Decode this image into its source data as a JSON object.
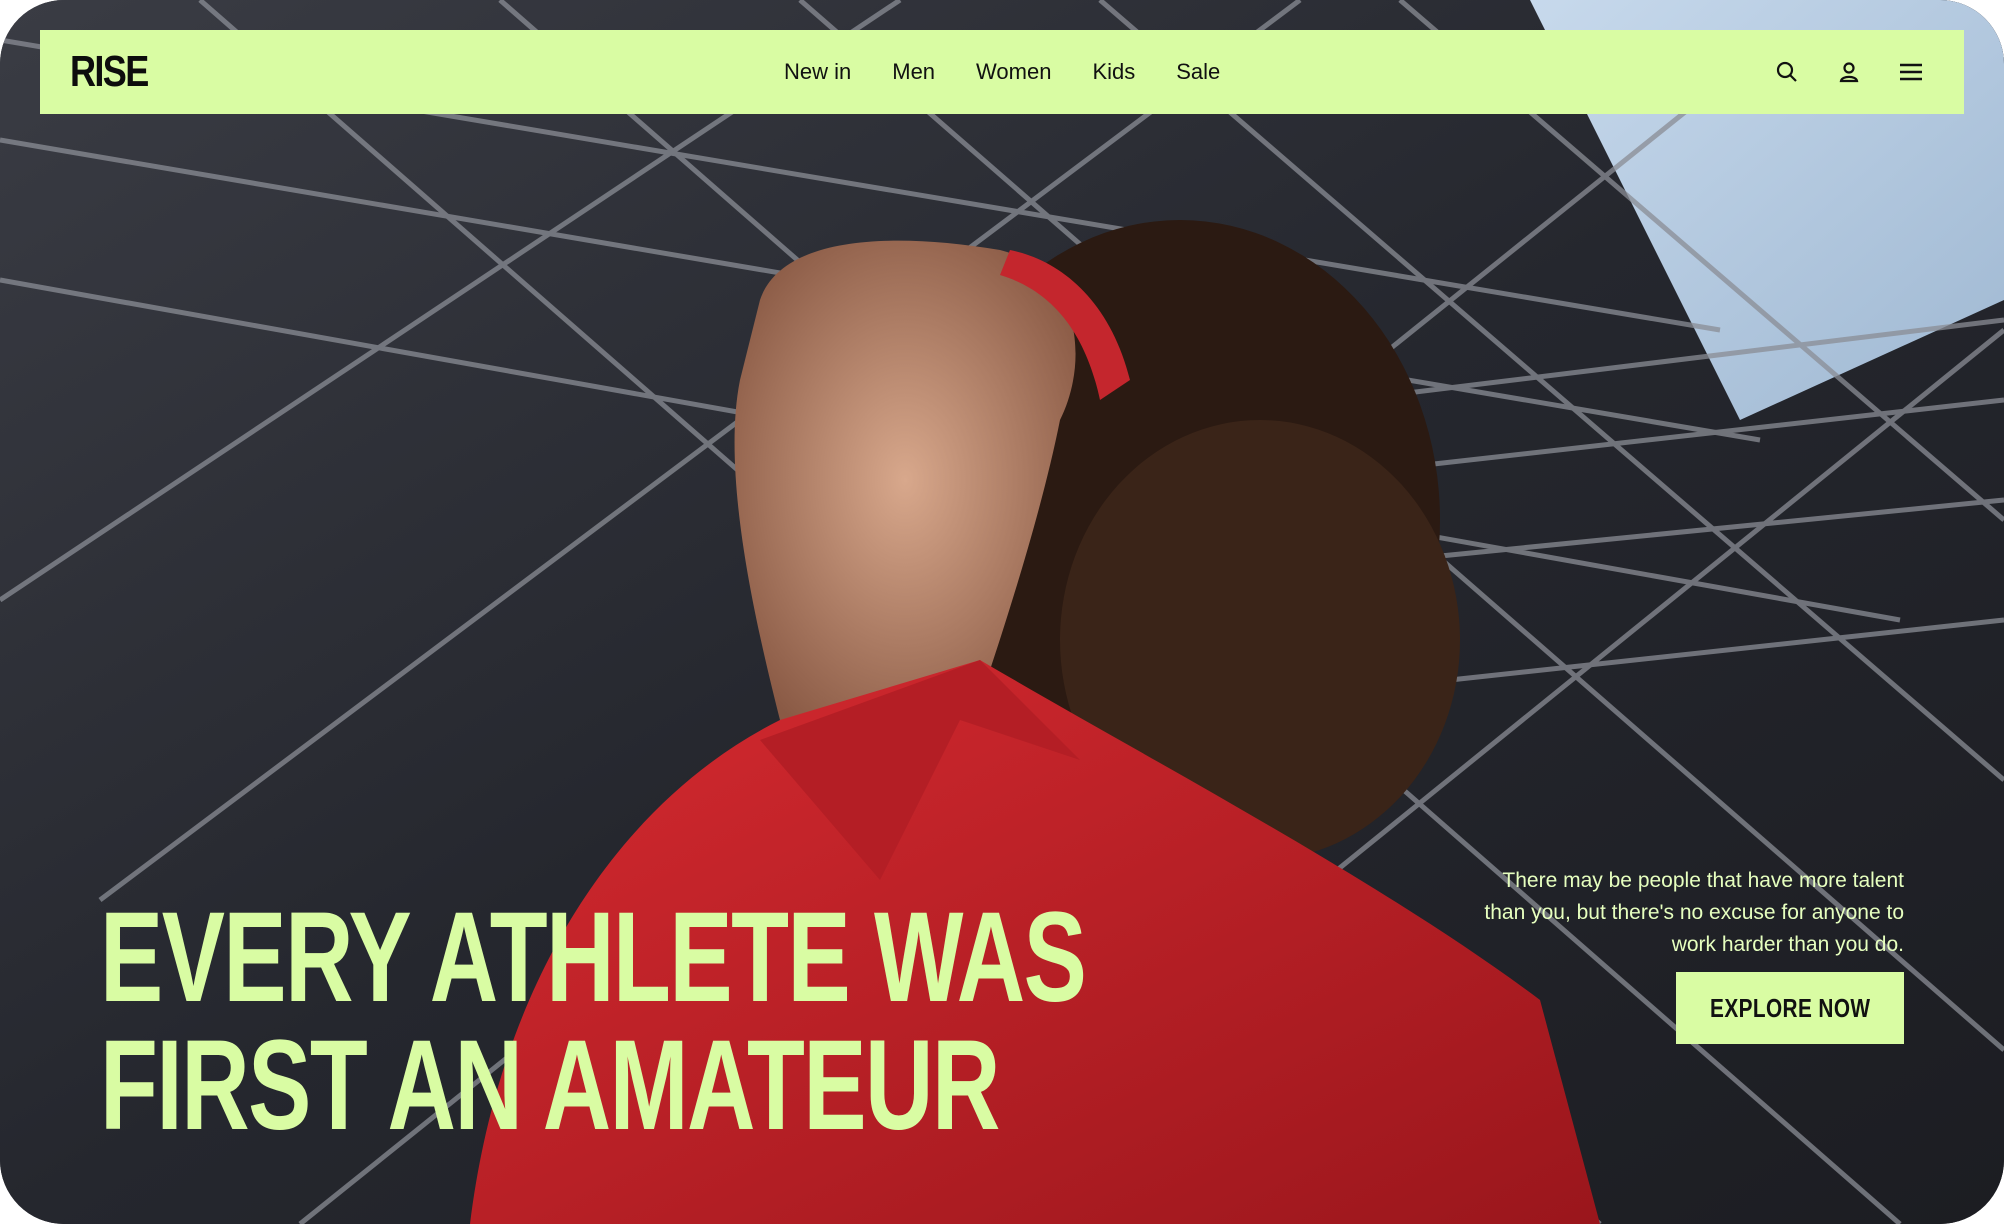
{
  "brand": {
    "logo_text": "RISE"
  },
  "nav": {
    "links": [
      {
        "label": "New in"
      },
      {
        "label": "Men"
      },
      {
        "label": "Women"
      },
      {
        "label": "Kids"
      },
      {
        "label": "Sale"
      }
    ],
    "icons": [
      "search-icon",
      "user-icon",
      "menu-icon"
    ]
  },
  "hero": {
    "headline_line1": "EVERY ATHLETE WAS",
    "headline_line2": "FIRST AN AMATEUR",
    "tagline": "There may be people that have more talent than you, but there's no excuse for anyone to work harder than you do.",
    "cta_label": "EXPLORE NOW"
  },
  "colors": {
    "accent": "#d9fca3",
    "shirt": "#c0222a",
    "dark": "#0d0d0d"
  }
}
